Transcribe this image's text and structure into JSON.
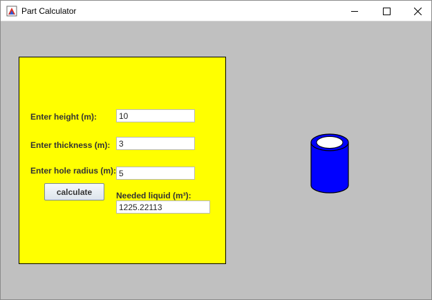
{
  "window": {
    "title": "Part Calculator",
    "icon": "java-app-icon",
    "controls": {
      "minimize": "minimize-icon",
      "maximize": "maximize-icon",
      "close": "close-icon"
    }
  },
  "form": {
    "height_label": "Enter height (m):",
    "height_value": "10",
    "thickness_label": "Enter thickness (m):",
    "thickness_value": "3",
    "hole_radius_label": "Enter hole radius (m):",
    "hole_radius_value": "5",
    "calculate_label": "calculate",
    "result_label": "Needed liquid (m³):",
    "result_value": "1225.22113"
  },
  "colors": {
    "panel": "#ffff00",
    "background": "#c0c0c0",
    "cylinder_fill": "#0000ff",
    "cylinder_hole": "#ffffff"
  }
}
